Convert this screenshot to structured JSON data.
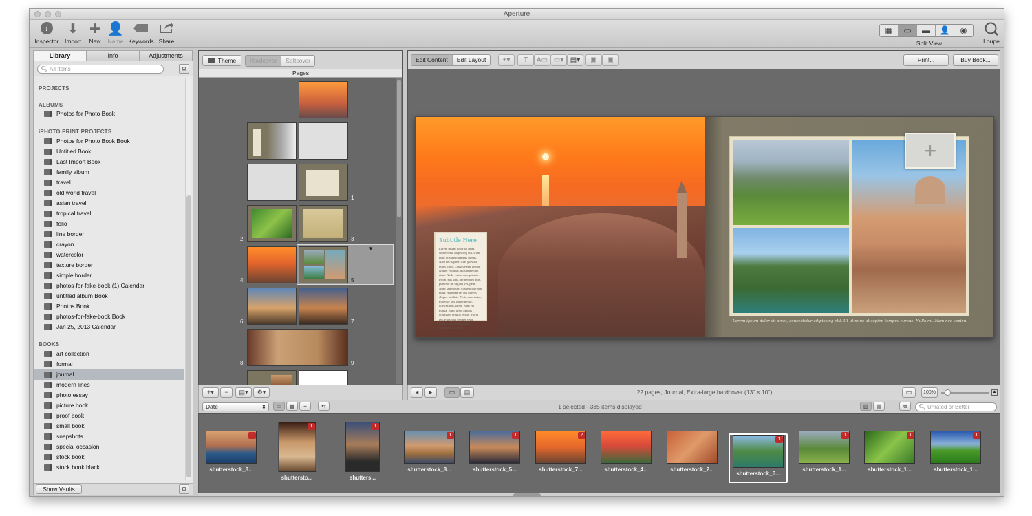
{
  "window": {
    "title": "Aperture"
  },
  "toolbar": {
    "inspector": "Inspector",
    "import": "Import",
    "new": "New",
    "name": "Name",
    "keywords": "Keywords",
    "share": "Share",
    "split_view": "Split View",
    "loupe": "Loupe"
  },
  "left": {
    "tabs": [
      "Library",
      "Info",
      "Adjustments"
    ],
    "search_placeholder": "All Items",
    "sections": {
      "projects": "PROJECTS",
      "albums": "ALBUMS",
      "iphoto": "iPHOTO PRINT PROJECTS",
      "books": "BOOKS"
    },
    "albums": [
      "Photos for Photo Book"
    ],
    "iphoto_projects": [
      "Photos for Photo Book Book",
      "Untitled Book",
      "Last Import Book",
      "family album",
      "travel",
      "old world travel",
      "asian travel",
      "tropical travel",
      "folio",
      "line border",
      "crayon",
      "watercolor",
      "texture border",
      "simple border",
      "photos-for-fake-book (1) Calendar",
      "untitled album Book",
      "Photos Book",
      "photos-for-fake-book Book",
      "Jan 25, 2013 Calendar"
    ],
    "books": [
      "art collection",
      "formal",
      "journal",
      "modern lines",
      "photo essay",
      "picture book",
      "proof book",
      "small book",
      "snapshots",
      "special occasion",
      "stock book",
      "stock book black"
    ],
    "selected_book": "journal",
    "show_vaults": "Show Vaults"
  },
  "pages_panel": {
    "theme": "Theme",
    "hardcover": "Hardcover",
    "softcover": "Softcover",
    "header": "Pages",
    "page_numbers": [
      "1",
      "2",
      "3",
      "4",
      "5",
      "6",
      "7",
      "8",
      "9"
    ]
  },
  "editor": {
    "edit_content": "Edit Content",
    "edit_layout": "Edit Layout",
    "print": "Print...",
    "buy_book": "Buy Book...",
    "subtitle": "Subtitle Here",
    "lorem": "Lorem ipsum dolor sit amet, consectetur adipiscing elit. Ut ut nunc ut sapien tempus cursus. Nam nec sapien. Cras gravida tellus tortor. Quisque erat ipsum, aliquet volutpat, quis imperdiet risus. Nulla varius suscipit ante. Proin felis urna, fermentum quis, pulvinar in, sagittis vel, pede. Nunc sed massa. Suspendisse non nulla. Aliquam vel dui id eros aliquet facilisis. Proin urna tortor, molestie sed, imperdiet ac, ultrices non, lacus. Nam vel massa. Nunc urna. Mauris dignissim feugiat lectus. Morbi leo. Phasellus semper velit, laoreet nec, euismod sed, consequat eu, pede.",
    "caption": "Lorem ipsum dolor sit amet, consectetur adipiscing elit. Ut ut nunc ut sapien tempus cursus. Nulla mi. Nam nec sapien. Cras gravida tellus tortor.",
    "page_info": "22 pages, Journal, Extra-large hardcover (13\" × 10\")",
    "zoom": "100%"
  },
  "browser": {
    "sort": "Date",
    "selection_info": "1 selected - 335 items displayed",
    "rating_filter": "Unrated or Better",
    "thumbs": [
      {
        "label": "shutterstock_8...",
        "badge": "1"
      },
      {
        "label": "shuttersto...",
        "badge": "1"
      },
      {
        "label": "shutters...",
        "badge": "1"
      },
      {
        "label": "shutterstock_8...",
        "badge": "1"
      },
      {
        "label": "shutterstock_5...",
        "badge": "1"
      },
      {
        "label": "shutterstock_7...",
        "badge": "2"
      },
      {
        "label": "shutterstock_4...",
        "badge": ""
      },
      {
        "label": "shutterstock_2...",
        "badge": ""
      },
      {
        "label": "shutterstock_6...",
        "badge": "1"
      },
      {
        "label": "shutterstock_1...",
        "badge": "1"
      },
      {
        "label": "shutterstock_1...",
        "badge": "1"
      },
      {
        "label": "shutterstock_1...",
        "badge": "1"
      }
    ]
  }
}
